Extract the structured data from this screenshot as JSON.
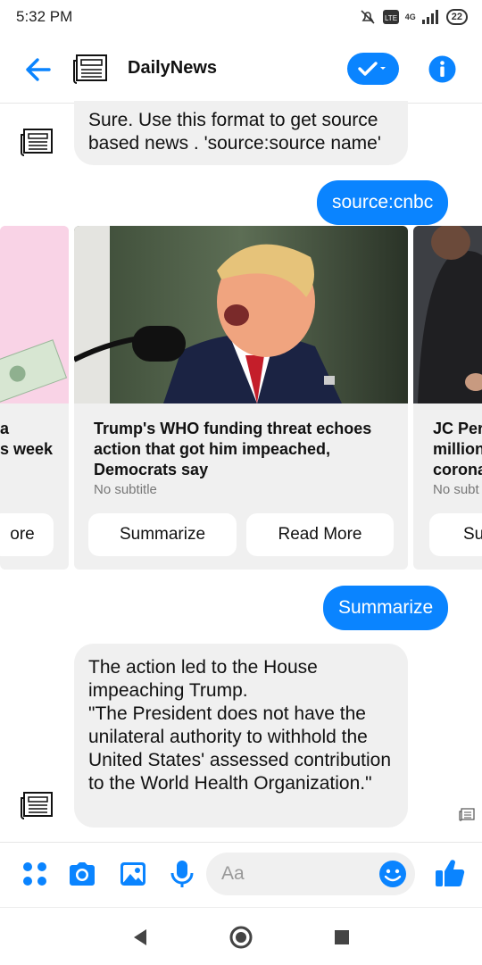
{
  "status": {
    "time": "5:32 PM",
    "network": "4G",
    "battery": "22"
  },
  "header": {
    "title": "DailyNews"
  },
  "messages": {
    "bot_intro": "Sure. Use this format to get source based news . 'source:source name'",
    "user_query": "source:cnbc",
    "user_summarize": "Summarize",
    "bot_summary": "The action led to the House impeaching Trump.\n\"The President does not have the unilateral authority to withhold the United States' assessed contribution to the World Health Organization.\""
  },
  "cards": [
    {
      "title": "a\ns week",
      "subtitle": "",
      "read_more": "ore"
    },
    {
      "title": "Trump's WHO funding threat echoes action that got him impeached, Democrats say",
      "subtitle": "No subtitle",
      "summarize": "Summarize",
      "read_more": "Read More"
    },
    {
      "title": "JC Per\nmillion\ncorona",
      "subtitle": "No subt",
      "summarize": "Sur"
    }
  ],
  "composer": {
    "placeholder": "Aa"
  },
  "colors": {
    "accent": "#0a84ff",
    "bubble_bg": "#f0f0f0"
  },
  "icons": [
    "back-arrow-icon",
    "newspaper-icon",
    "check-dropdown-icon",
    "info-icon",
    "apps-icon",
    "camera-icon",
    "image-icon",
    "microphone-icon",
    "emoji-icon",
    "thumbs-up-icon",
    "nav-back-icon",
    "nav-home-icon",
    "nav-recent-icon"
  ]
}
